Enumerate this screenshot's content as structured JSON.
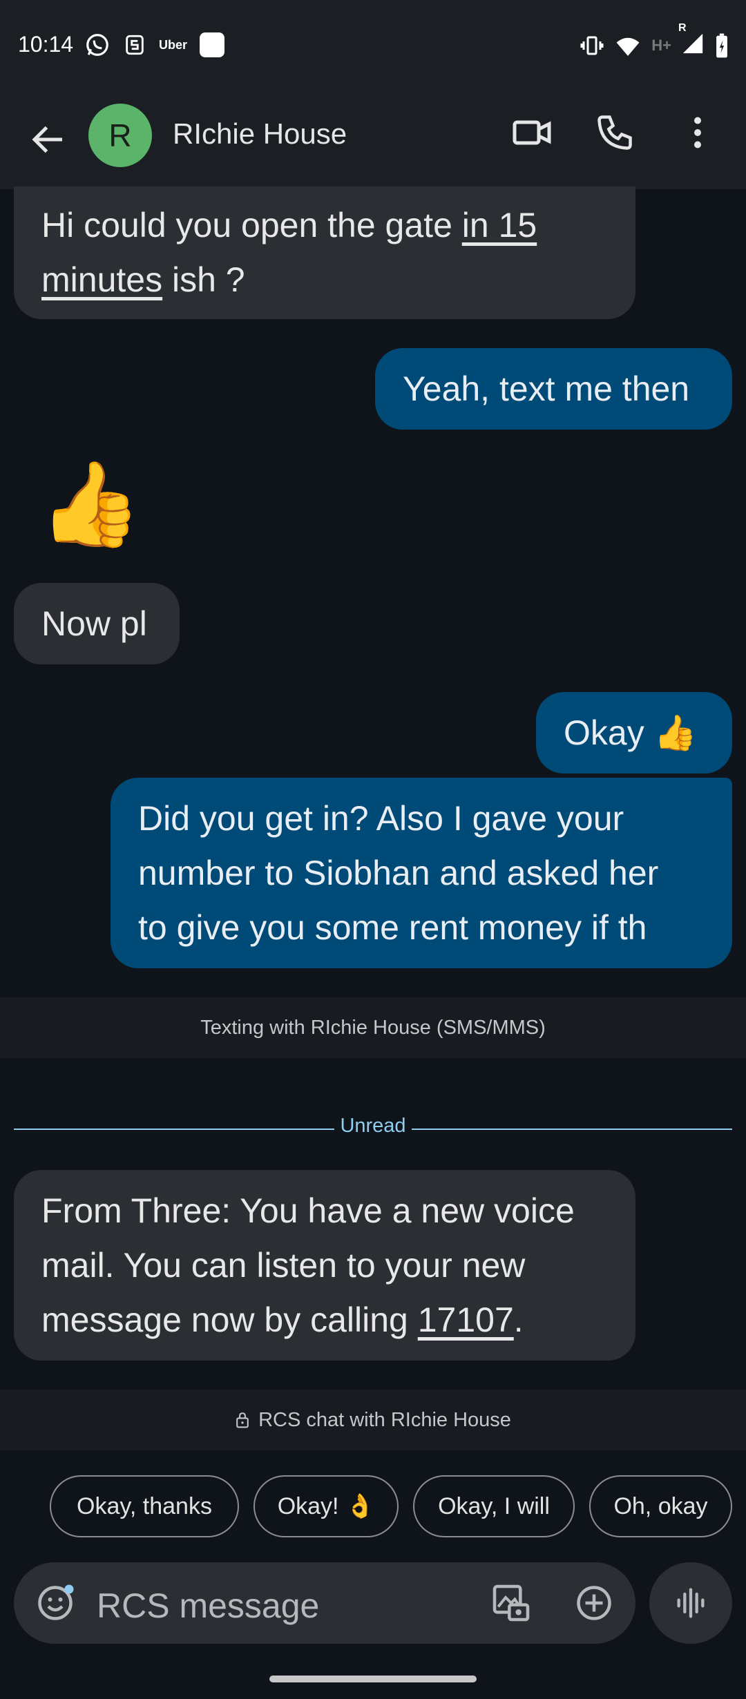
{
  "status_bar": {
    "time": "10:14",
    "left_icons": [
      "whatsapp-icon",
      "app-s-icon",
      "uber-icon",
      "app-white-icon"
    ],
    "uber_text": "Uber",
    "network": "H+",
    "roaming": "R",
    "right_icons": [
      "vibrate-icon",
      "wifi-icon",
      "signal-icon",
      "battery-charging-icon"
    ]
  },
  "header": {
    "avatar_letter": "R",
    "avatar_color": "#5cb46a",
    "contact_name": "RIchie House",
    "icons": [
      "back-arrow-icon",
      "video-call-icon",
      "phone-icon",
      "more-vert-icon"
    ]
  },
  "messages": [
    {
      "dir": "in",
      "parts": [
        {
          "t": "Hi could you open the gate "
        },
        {
          "t": "in 15",
          "link": true
        }
      ],
      "line2": [
        {
          "t": "minutes",
          "link": true
        },
        {
          "t": " ish ?"
        }
      ]
    },
    {
      "dir": "out",
      "text": "Yeah, text me then"
    },
    {
      "dir": "in",
      "emoji": "👍"
    },
    {
      "dir": "in",
      "text": "Now pl"
    },
    {
      "dir": "out",
      "text": "Okay 👍"
    },
    {
      "dir": "out",
      "lines": [
        "Did you get in? Also I gave your",
        "number to Siobhan and asked her",
        "to give you some rent money if th"
      ]
    }
  ],
  "sms_band": "Texting with RIchie House (SMS/MMS)",
  "unread_label": "Unread",
  "voicemail": {
    "line1": "From Three: You have a new voice",
    "line2": "mail. You can listen to your new",
    "line3_prefix": "message now by calling ",
    "line3_number": "17107",
    "line3_suffix": "."
  },
  "rcs_band": "RCS chat with RIchie House",
  "suggestions": [
    "Okay, thanks",
    "Okay! 👌",
    "Okay, I will",
    "Oh, okay"
  ],
  "compose": {
    "placeholder": "RCS message",
    "icons": [
      "emoji-icon",
      "gallery-icon",
      "add-icon",
      "voice-icon"
    ]
  },
  "colors": {
    "background": "#0f141a",
    "incoming_bubble": "#2b2e33",
    "outgoing_bubble": "#004a77",
    "accent": "#8fcdf0"
  }
}
